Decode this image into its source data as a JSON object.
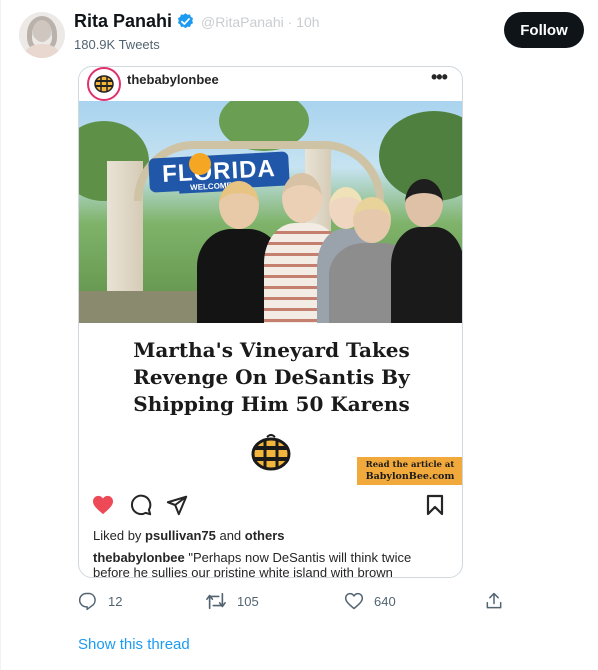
{
  "header": {
    "display_name": "Rita Panahi",
    "handle": "@RitaPanahi · 10h",
    "tweet_count": "180.9K Tweets",
    "follow_label": "Follow"
  },
  "post": {
    "ig_username": "thebabylonbee",
    "ig_more": "•••",
    "image_sign": "FLORIDA",
    "image_sign_sub": "WELCOME",
    "headline_lines": [
      "Martha's Vineyard Takes",
      "Revenge On DeSantis By",
      "Shipping Him 50 Karens"
    ],
    "read_box_lines": [
      "Read the article at",
      "BabylonBee.com"
    ],
    "liked_prefix": "Liked by ",
    "liked_user": "psullivan75",
    "liked_mid": " and ",
    "liked_others": "others",
    "caption_user": "thebabylonbee",
    "caption_text": " \"Perhaps now DeSantis will think twice before he sullies our pristine white island with brown"
  },
  "actions": {
    "replies": "12",
    "retweets": "105",
    "likes": "640"
  },
  "thread_link": "Show this thread",
  "colors": {
    "accent": "#1d9bf0",
    "follow_bg": "#0f1419",
    "like_red": "#ed4956",
    "read_box": "#f2a93b"
  }
}
